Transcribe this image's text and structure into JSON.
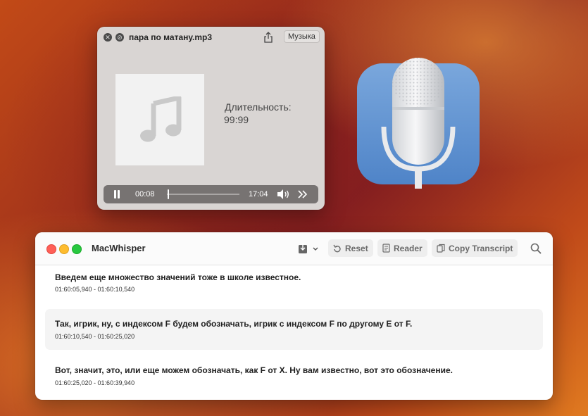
{
  "colors": {
    "quicklook_bg": "#d9d5d3",
    "controls_bg": "#777372",
    "traffic_red": "#ff5f57",
    "traffic_yellow": "#febc2e",
    "traffic_green": "#28c840",
    "icon_blue": "#5b8fd0"
  },
  "quicklook": {
    "title": "пара по матану.mp3",
    "app_button": "Музыка",
    "duration_label": "Длительность:",
    "duration_value": "99:99",
    "elapsed": "00:08",
    "total": "17:04",
    "playback_progress": 0.008,
    "icons": [
      "close-icon",
      "block-icon",
      "share-icon",
      "music-note-icon",
      "pause-icon",
      "volume-icon",
      "fast-forward-icon"
    ]
  },
  "app_icon": {
    "icon": "microphone-icon"
  },
  "macwhisper": {
    "title": "MacWhisper",
    "toolbar": {
      "reset_label": "Reset",
      "reader_label": "Reader",
      "copy_label": "Copy Transcript"
    },
    "segments": [
      {
        "text": "Введем еще множество значений тоже в школе известное.",
        "time": "01:60:05,940 - 01:60:10,540"
      },
      {
        "text": "Так, игрик, ну, с индексом F будем обозначать, игрик с индексом F по другому E от F.",
        "time": "01:60:10,540 - 01:60:25,020"
      },
      {
        "text": "Вот, значит, это, или еще можем обозначать, как F от X. Ну вам известно, вот это обозначение.",
        "time": "01:60:25,020 - 01:60:39,940"
      }
    ]
  }
}
